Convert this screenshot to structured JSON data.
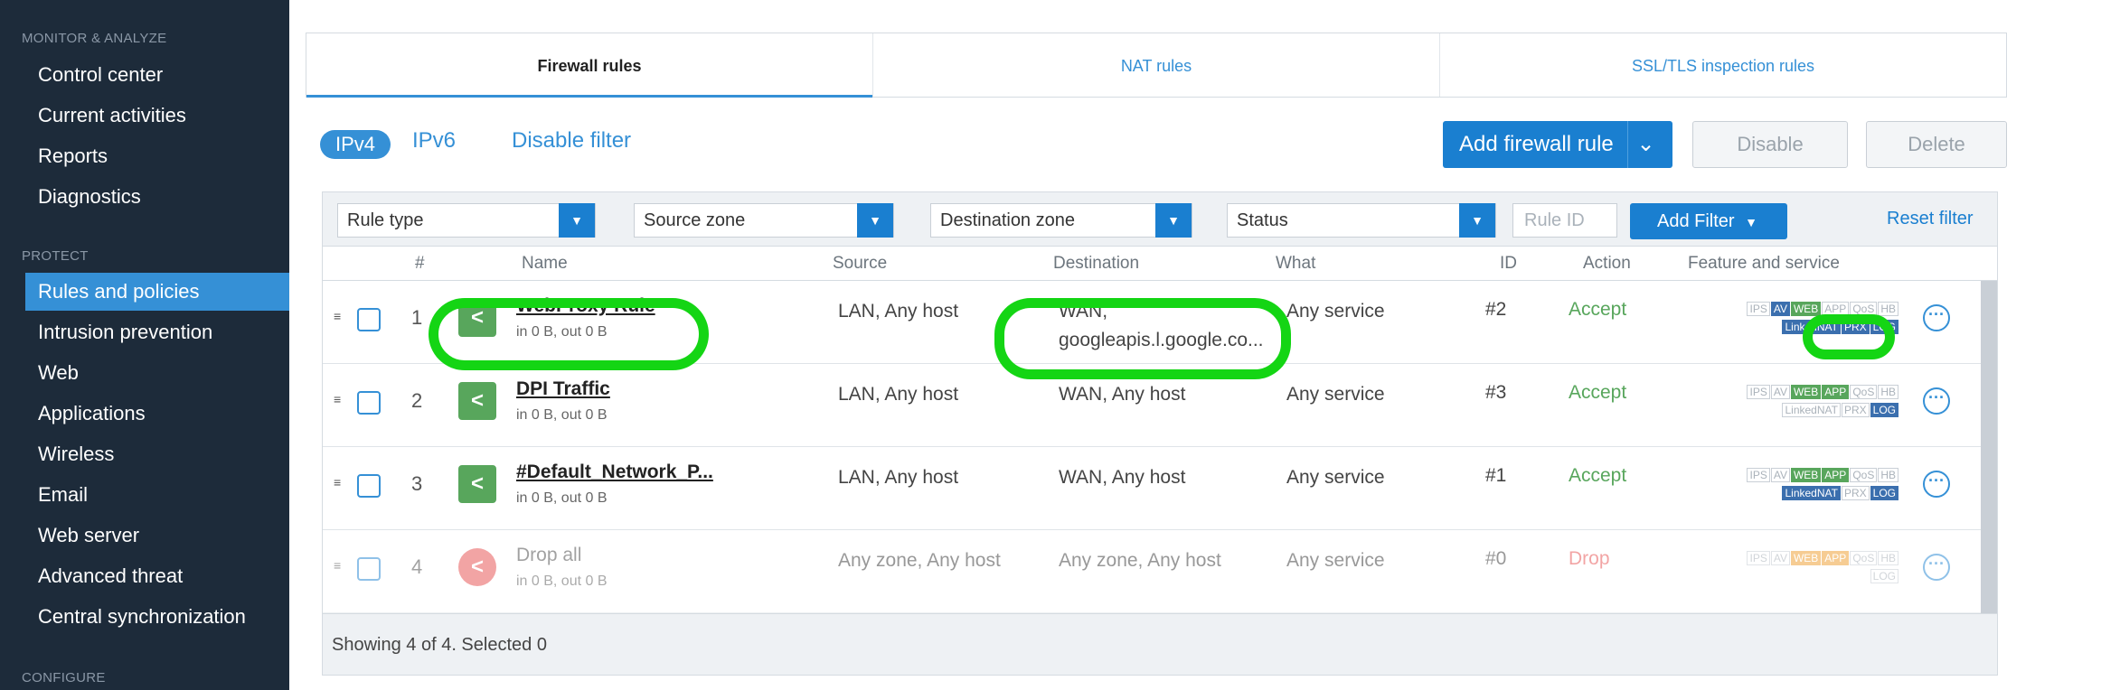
{
  "sidebar": {
    "section_monitor": "MONITOR & ANALYZE",
    "section_protect": "PROTECT",
    "section_configure": "CONFIGURE",
    "monitor_items": [
      "Control center",
      "Current activities",
      "Reports",
      "Diagnostics"
    ],
    "protect_items": [
      "Rules and policies",
      "Intrusion prevention",
      "Web",
      "Applications",
      "Wireless",
      "Email",
      "Web server",
      "Advanced threat",
      "Central synchronization"
    ],
    "active": "Rules and policies"
  },
  "tabs": [
    "Firewall rules",
    "NAT rules",
    "SSL/TLS inspection rules"
  ],
  "active_tab": "Firewall rules",
  "toolbar": {
    "ipv4": "IPv4",
    "ipv6": "IPv6",
    "disable_filter": "Disable filter",
    "add_rule": "Add firewall rule",
    "disable": "Disable",
    "delete": "Delete"
  },
  "filters": {
    "rule_type": "Rule type",
    "source_zone": "Source zone",
    "destination_zone": "Destination zone",
    "status": "Status",
    "rule_id_placeholder": "Rule ID",
    "add_filter": "Add Filter",
    "reset_filter": "Reset filter"
  },
  "columns": [
    "#",
    "Name",
    "Source",
    "Destination",
    "What",
    "ID",
    "Action",
    "Feature and service"
  ],
  "rows": [
    {
      "num": "1",
      "name": "WebProxy Rule",
      "traffic": "in 0 B, out 0 B",
      "source": "LAN, Any host",
      "dest1": "WAN,",
      "dest2": "googleapis.l.google.co...",
      "what": "Any service",
      "id": "#2",
      "action": "Accept"
    },
    {
      "num": "2",
      "name": "DPI Traffic",
      "traffic": "in 0 B, out 0 B",
      "source": "LAN, Any host",
      "dest1": "WAN, Any host",
      "dest2": "",
      "what": "Any service",
      "id": "#3",
      "action": "Accept"
    },
    {
      "num": "3",
      "name": "#Default_Network_P...",
      "traffic": "in 0 B, out 0 B",
      "source": "LAN, Any host",
      "dest1": "WAN, Any host",
      "dest2": "",
      "what": "Any service",
      "id": "#1",
      "action": "Accept"
    },
    {
      "num": "4",
      "name": "Drop all",
      "traffic": "in 0 B, out 0 B",
      "source": "Any zone, Any host",
      "dest1": "Any zone, Any host",
      "dest2": "",
      "what": "Any service",
      "id": "#0",
      "action": "Drop"
    }
  ],
  "badges": {
    "ips": "IPS",
    "av": "AV",
    "web": "WEB",
    "app": "APP",
    "qos": "QoS",
    "hb": "HB",
    "linkednat": "LinkedNAT",
    "prx": "PRX",
    "log": "LOG"
  },
  "footer": "Showing 4 of 4. Selected 0",
  "colors": {
    "sidebar_bg": "#1d2b3a",
    "accent": "#3590d6",
    "accept": "#58a65c",
    "drop": "#e85a5a",
    "highlight": "#14d514"
  }
}
